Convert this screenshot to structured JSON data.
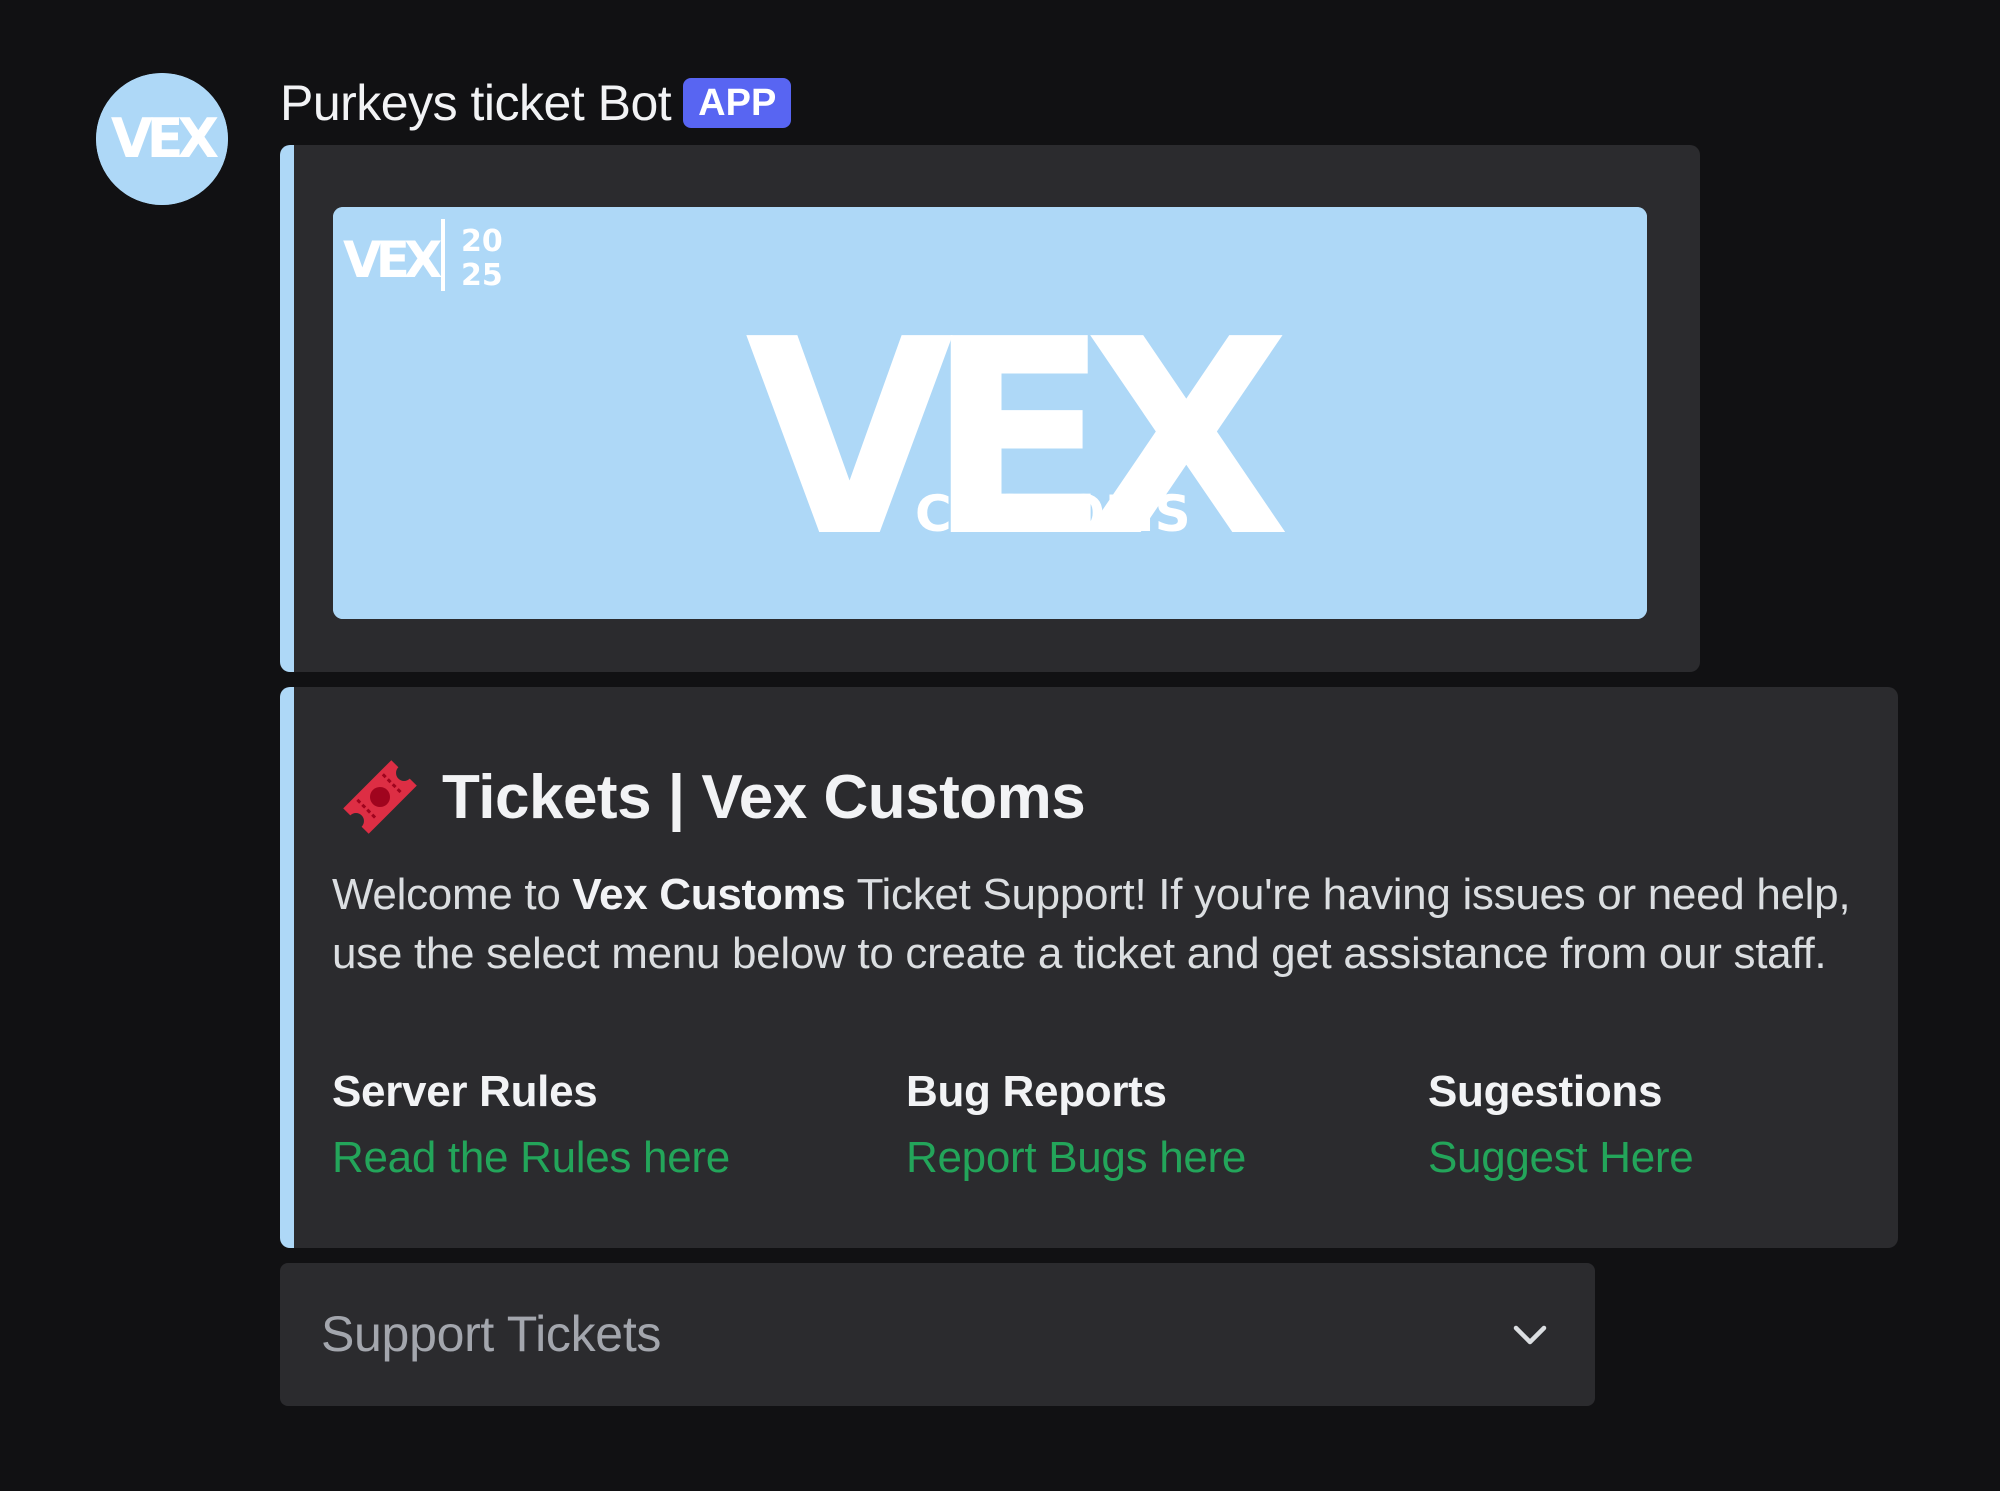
{
  "message": {
    "author": "Purkeys ticket Bot",
    "badge": "APP",
    "avatar_icon": "vex-logo-icon"
  },
  "banner": {
    "corner_logo_text": "VEX",
    "corner_year_top": "20",
    "corner_year_bottom": "25",
    "main_logo_text": "VEX",
    "main_logo_subtext": "CUSTOMS",
    "background_color": "#aed8f7"
  },
  "embed": {
    "icon": "ticket-icon",
    "title": "Tickets | Vex Customs",
    "description_prefix": "Welcome to ",
    "description_bold": "Vex Customs",
    "description_suffix": " Ticket Support! If you're having issues or need help, use the select menu below to create a ticket and get assistance from our staff.",
    "fields": [
      {
        "name": "Server Rules",
        "value": "Read the Rules here"
      },
      {
        "name": "Bug Reports",
        "value": "Report Bugs here"
      },
      {
        "name": "Sugestions",
        "value": "Suggest Here"
      }
    ],
    "accent_color": "#aed8f7",
    "link_color": "#23a55a"
  },
  "select_menu": {
    "placeholder": "Support Tickets",
    "icon": "chevron-down-icon"
  }
}
